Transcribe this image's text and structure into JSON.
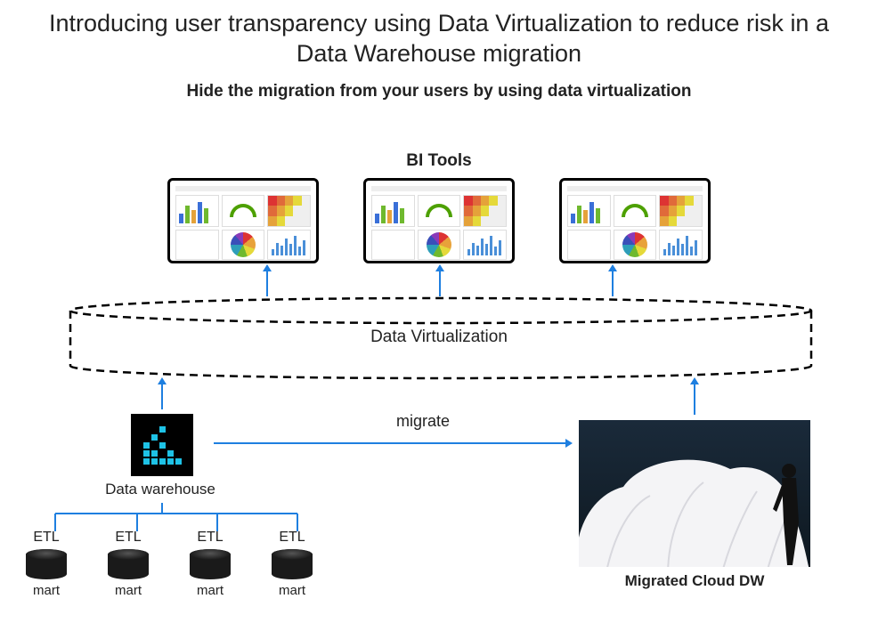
{
  "title": "Introducing user transparency using Data Virtualization to reduce risk in a Data Warehouse migration",
  "subtitle": "Hide the migration from your users by using data virtualization",
  "labels": {
    "bi_tools": "BI Tools",
    "data_virtualization": "Data Virtualization",
    "data_warehouse": "Data warehouse",
    "migrate": "migrate",
    "migrated_cloud_dw": "Migrated Cloud DW"
  },
  "etl_items": [
    {
      "etl": "ETL",
      "mart": "mart"
    },
    {
      "etl": "ETL",
      "mart": "mart"
    },
    {
      "etl": "ETL",
      "mart": "mart"
    },
    {
      "etl": "ETL",
      "mart": "mart"
    }
  ],
  "bi_dashboards": [
    1,
    2,
    3
  ],
  "colors": {
    "arrow": "#1e7fe0",
    "dw_icon_bg": "#000000",
    "dw_icon_accent": "#1ec2e6"
  }
}
